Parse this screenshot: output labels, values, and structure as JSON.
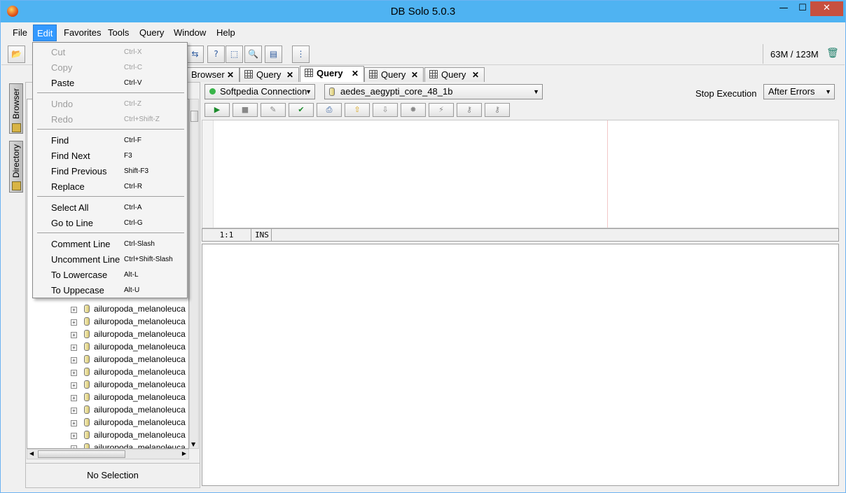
{
  "window": {
    "title": "DB Solo  5.0.3"
  },
  "menubar": [
    "File",
    "Edit",
    "Favorites",
    "Tools",
    "Query",
    "Window",
    "Help"
  ],
  "memory": {
    "used": "63M",
    "total": "123M",
    "display": "63M / 123M"
  },
  "tabs": [
    {
      "label": "Browser",
      "active": false
    },
    {
      "label": "Query",
      "active": false
    },
    {
      "label": "Query",
      "active": true
    },
    {
      "label": "Query",
      "active": false
    },
    {
      "label": "Query",
      "active": false
    }
  ],
  "sidetabs": [
    "Browser",
    "Directory"
  ],
  "tree": {
    "items": [
      "ailuropoda_melanoleuca",
      "ailuropoda_melanoleuca",
      "ailuropoda_melanoleuca",
      "ailuropoda_melanoleuca",
      "ailuropoda_melanoleuca",
      "ailuropoda_melanoleuca",
      "ailuropoda_melanoleuca",
      "ailuropoda_melanoleuca",
      "ailuropoda_melanoleuca",
      "ailuropoda_melanoleuca",
      "ailuropoda_melanoleuca",
      "ailuropoda_melanoleuca"
    ]
  },
  "selection": {
    "text": "No Selection"
  },
  "query": {
    "connection": "Softpedia Connection",
    "database": "aedes_aegypti_core_48_1b",
    "stop_label": "Stop Execution",
    "stop_option": "After Errors"
  },
  "editor_status": {
    "position": "1:1",
    "mode": "INS"
  },
  "edit_menu": [
    {
      "label": "Cut",
      "shortcut": "Ctrl-X",
      "disabled": true
    },
    {
      "label": "Copy",
      "shortcut": "Ctrl-C",
      "disabled": true
    },
    {
      "label": "Paste",
      "shortcut": "Ctrl-V",
      "disabled": false
    },
    {
      "label": "Undo",
      "shortcut": "Ctrl-Z",
      "disabled": true
    },
    {
      "label": "Redo",
      "shortcut": "Ctrl+Shift-Z",
      "disabled": true
    },
    {
      "label": "Find",
      "shortcut": "Ctrl-F",
      "disabled": false
    },
    {
      "label": "Find Next",
      "shortcut": "F3",
      "disabled": false
    },
    {
      "label": "Find Previous",
      "shortcut": "Shift-F3",
      "disabled": false
    },
    {
      "label": "Replace",
      "shortcut": "Ctrl-R",
      "disabled": false
    },
    {
      "label": "Select All",
      "shortcut": "Ctrl-A",
      "disabled": false
    },
    {
      "label": "Go to Line",
      "shortcut": "Ctrl-G",
      "disabled": false
    },
    {
      "label": "Comment Line",
      "shortcut": "Ctrl-Slash",
      "disabled": false
    },
    {
      "label": "Uncomment Line",
      "shortcut": "Ctrl+Shift-Slash",
      "disabled": false
    },
    {
      "label": "To Lowercase",
      "shortcut": "Alt-L",
      "disabled": false
    },
    {
      "label": "To Uppecase",
      "shortcut": "Alt-U",
      "disabled": false
    }
  ],
  "colors": {
    "titlebar": "#4fb3f2",
    "close": "#c7503f",
    "menu_highlight": "#3399ff"
  },
  "icons": {
    "app": "app-icon",
    "toolbar": [
      "open-folder-icon",
      "connection-icon",
      "table-icon",
      "help-query-icon",
      "move-icon",
      "search-icon",
      "copy-icon",
      "tree-icon"
    ],
    "query_buttons": [
      "run-icon",
      "stop-icon",
      "edit-icon",
      "check-icon",
      "print-icon",
      "up-icon",
      "down-icon",
      "bug-icon",
      "wand-icon",
      "key-icon",
      "key2-icon"
    ]
  }
}
